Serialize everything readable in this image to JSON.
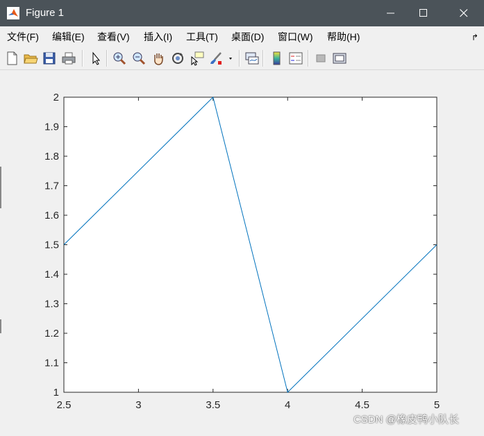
{
  "window": {
    "title": "Figure 1"
  },
  "menu": [
    {
      "label": "文件(F)",
      "name": "menu-file"
    },
    {
      "label": "编辑(E)",
      "name": "menu-edit"
    },
    {
      "label": "查看(V)",
      "name": "menu-view"
    },
    {
      "label": "插入(I)",
      "name": "menu-insert"
    },
    {
      "label": "工具(T)",
      "name": "menu-tools"
    },
    {
      "label": "桌面(D)",
      "name": "menu-desktop"
    },
    {
      "label": "窗口(W)",
      "name": "menu-window"
    },
    {
      "label": "帮助(H)",
      "name": "menu-help"
    }
  ],
  "toolbar": [
    "new-figure-icon",
    "open-file-icon",
    "save-icon",
    "print-icon",
    "pointer-icon",
    "zoom-in-icon",
    "zoom-out-icon",
    "pan-hand-icon",
    "rotate-3d-icon",
    "data-cursor-icon",
    "brush-icon",
    "link-plot-icon",
    "colorbar-icon",
    "legend-icon",
    "hide-plot-tools-icon",
    "show-plot-tools-icon"
  ],
  "chart_data": {
    "type": "line",
    "x": [
      2.5,
      3.5,
      4,
      5
    ],
    "y": [
      1.5,
      2,
      1,
      1.5
    ],
    "xlim": [
      2.5,
      5
    ],
    "ylim": [
      1,
      2
    ],
    "xticks": [
      "2.5",
      "3",
      "3.5",
      "4",
      "4.5",
      "5"
    ],
    "yticks": [
      "1",
      "1.1",
      "1.2",
      "1.3",
      "1.4",
      "1.5",
      "1.6",
      "1.7",
      "1.8",
      "1.9",
      "2"
    ],
    "line_color": "#0072bd",
    "grid": false
  },
  "watermark": "CSDN @橡皮鸭小队长"
}
